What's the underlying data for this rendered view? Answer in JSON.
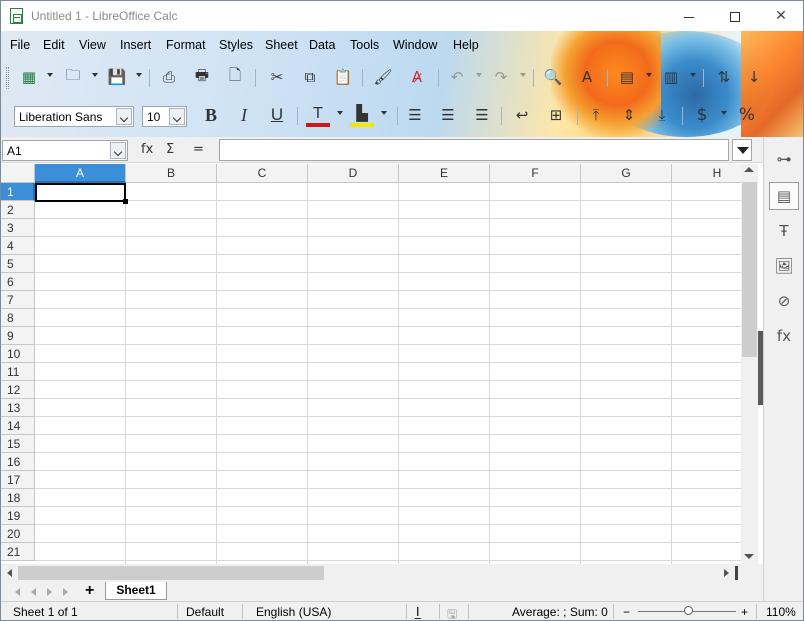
{
  "window": {
    "title": "Untitled 1 - LibreOffice Calc"
  },
  "menu": [
    "File",
    "Edit",
    "View",
    "Insert",
    "Format",
    "Styles",
    "Sheet",
    "Data",
    "Tools",
    "Window",
    "Help"
  ],
  "format_toolbar": {
    "font_name": "Liberation Sans",
    "font_size": "10"
  },
  "formula_bar": {
    "name_box": "A1",
    "function_wizard": "fx",
    "sum": "Σ",
    "equals": "=",
    "content": ""
  },
  "columns": [
    "A",
    "B",
    "C",
    "D",
    "E",
    "F",
    "G",
    "H"
  ],
  "rows": [
    "1",
    "2",
    "3",
    "4",
    "5",
    "6",
    "7",
    "8",
    "9",
    "10",
    "11",
    "12",
    "13",
    "14",
    "15",
    "16",
    "17",
    "18",
    "19",
    "20",
    "21"
  ],
  "active_cell": "A1",
  "sheets": {
    "tabs": [
      "Sheet1"
    ],
    "add_label": "+"
  },
  "status": {
    "sheet_position": "Sheet 1 of 1",
    "page_style": "Default",
    "language": "English (USA)",
    "selection_summary": "Average: ; Sum: 0",
    "zoom": "110%",
    "zoom_out": "−",
    "zoom_in": "+"
  },
  "colors": {
    "accent": "#3b8fd9",
    "header_bg": "#f3f3f3",
    "grid": "#d9d9d9"
  }
}
